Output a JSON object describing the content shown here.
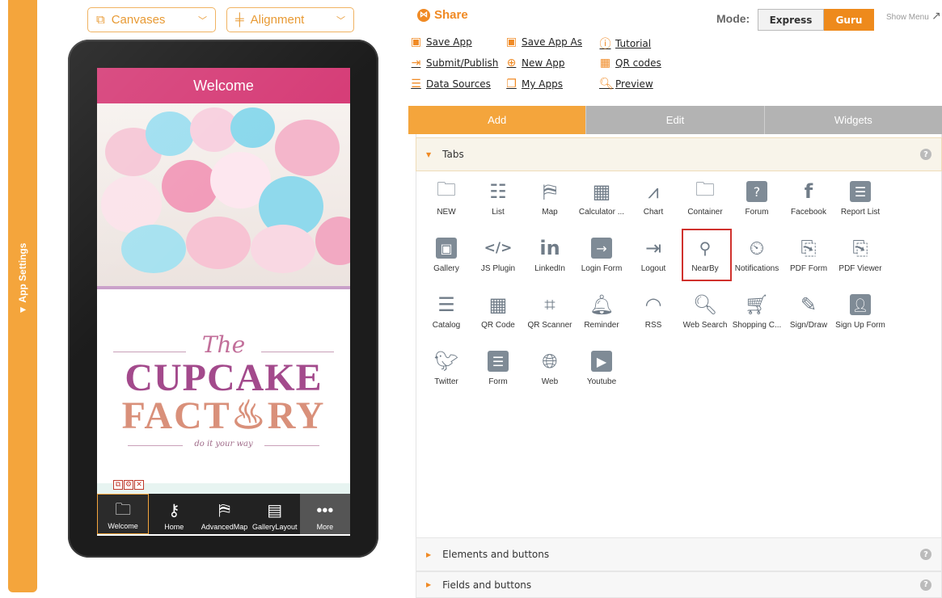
{
  "left_bar": {
    "label": "▼ App Settings"
  },
  "toolbar": {
    "canvases_label": "Canvases",
    "alignment_label": "Alignment"
  },
  "preview": {
    "header_title": "Welcome",
    "logo_the": "The",
    "logo_line1": "CUPCAKE",
    "logo_line2": "FACT♨RY",
    "logo_tagline": "do it your way",
    "tabs": [
      {
        "label": "Welcome",
        "icon": "folder-icon"
      },
      {
        "label": "Home",
        "icon": "key-icon"
      },
      {
        "label": "AdvancedMap",
        "icon": "map-icon"
      },
      {
        "label": "GalleryLayout",
        "icon": "film-icon"
      },
      {
        "label": "More",
        "icon": "more-icon"
      }
    ]
  },
  "share": {
    "label": "Share"
  },
  "actions": [
    {
      "label": "Save App",
      "icon": "save-icon"
    },
    {
      "label": "Save App As",
      "icon": "save-as-icon"
    },
    {
      "label": "Tutorial",
      "icon": "help-icon"
    },
    {
      "label": "Submit/Publish",
      "icon": "submit-icon"
    },
    {
      "label": "New App",
      "icon": "plus-icon"
    },
    {
      "label": "QR codes",
      "icon": "qr-icon"
    },
    {
      "label": "Data Sources",
      "icon": "database-icon"
    },
    {
      "label": "My Apps",
      "icon": "apps-icon"
    },
    {
      "label": "Preview",
      "icon": "search-icon"
    }
  ],
  "mode": {
    "label": "Mode:",
    "express": "Express",
    "guru": "Guru",
    "show_menu": "Show Menu"
  },
  "panel_tabs": [
    "Add",
    "Edit",
    "Widgets"
  ],
  "sections": {
    "tabs": "Tabs",
    "elements": "Elements and buttons",
    "fields": "Fields and buttons"
  },
  "widgets": [
    "NEW",
    "List",
    "Map",
    "Calculator ...",
    "Chart",
    "Container",
    "Forum",
    "Facebook",
    "Report List",
    "Gallery",
    "JS Plugin",
    "LinkedIn",
    "Login Form",
    "Logout",
    "NearBy",
    "Notifications",
    "PDF Form",
    "PDF Viewer",
    "Catalog",
    "QR Code",
    "QR Scanner",
    "Reminder",
    "RSS",
    "Web Search",
    "Shopping C...",
    "Sign/Draw",
    "Sign Up Form",
    "Twitter",
    "Form",
    "Web",
    "Youtube"
  ],
  "colors": {
    "accent": "#f4a53c",
    "header_pink": "#d63e78",
    "highlight": "#d0312d"
  }
}
